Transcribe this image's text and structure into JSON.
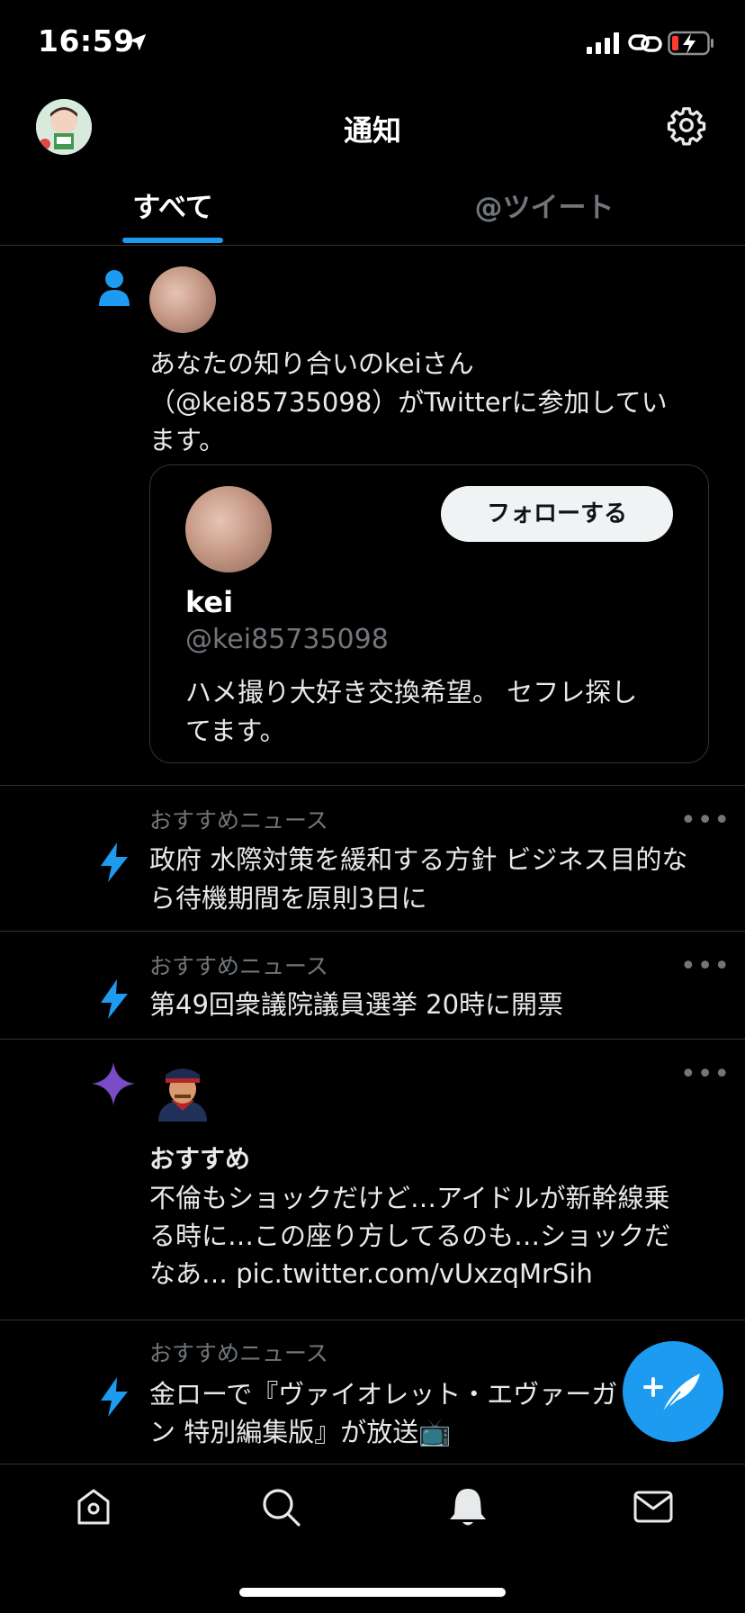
{
  "status_bar": {
    "time": "16:59"
  },
  "header": {
    "title": "通知"
  },
  "tabs": [
    {
      "label": "すべて",
      "selected": true
    },
    {
      "label": "@ツイート",
      "selected": false
    }
  ],
  "notifications": {
    "join": {
      "line1": "あなたの知り合いのkeiさん",
      "line2": "（@kei85735098）がTwitterに参加してい",
      "line3": "ます。",
      "card": {
        "name": "kei",
        "handle": "@kei85735098",
        "bio_line1": "ハメ撮り大好き交換希望。 セフレ探し",
        "bio_line2": "てます。",
        "follow_label": "フォローする"
      }
    },
    "news1": {
      "label": "おすすめニュース",
      "line1": "政府 水際対策を緩和する方針 ビジネス目的な",
      "line2": "ら待機期間を原則3日に",
      "more": "•••"
    },
    "news2": {
      "label": "おすすめニュース",
      "line1": "第49回衆議院議員選挙 20時に開票",
      "more": "•••"
    },
    "recommend": {
      "label": "おすすめ",
      "line1": "不倫もショックだけど…アイドルが新幹線乗",
      "line2": "る時に…この座り方してるのも…ショックだ",
      "line3": "なあ… pic.twitter.com/vUxzqMrSih",
      "more": "•••"
    },
    "news3": {
      "label": "おすすめニュース",
      "line1": "金ローで『ヴァイオレット・エヴァーガーデ",
      "line2": "ン 特別編集版』が放送📺"
    }
  },
  "colors": {
    "accent": "#1d9bf0",
    "sparkle": "#794bc4",
    "background": "#000000"
  },
  "icons": [
    "location-arrow-icon",
    "signal-icon",
    "link-icon",
    "battery-charging-icon",
    "gear-icon",
    "person-icon",
    "lightning-icon",
    "sparkle-icon",
    "compose-icon",
    "home-icon",
    "search-icon",
    "bell-icon",
    "mail-icon"
  ]
}
